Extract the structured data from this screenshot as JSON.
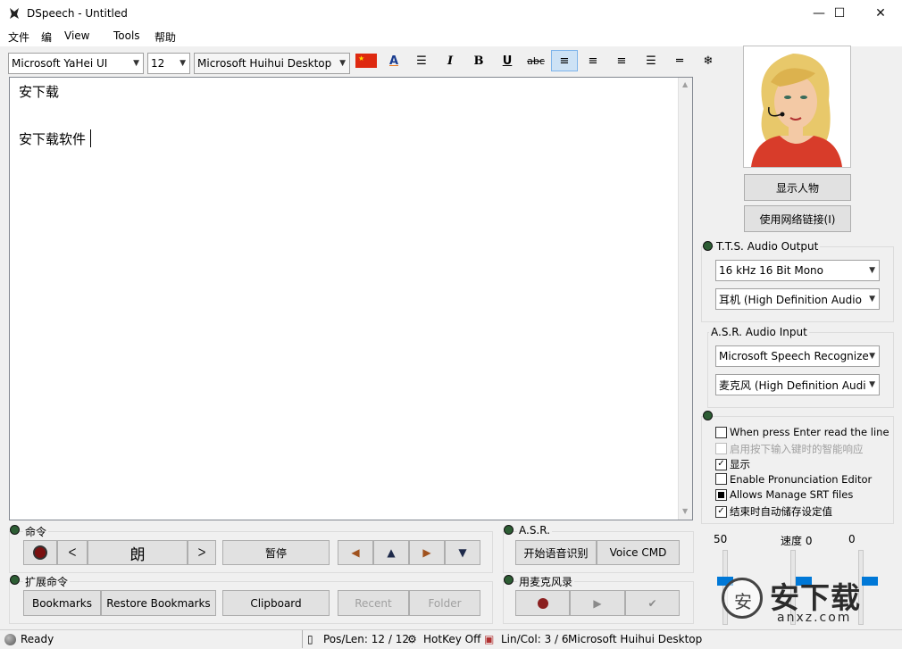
{
  "window": {
    "title": "DSpeech - Untitled",
    "minimize": "—",
    "maximize": "☐",
    "close": "✕"
  },
  "menu": [
    "文件",
    "编",
    "View",
    "Tools",
    "帮助"
  ],
  "toolbar": {
    "font_name": "Microsoft YaHei UI",
    "font_size": "12",
    "voice": "Microsoft Huihui Desktop",
    "italic": "I",
    "bold": "B",
    "underline": "U",
    "strike": "abc"
  },
  "editor": {
    "lines": [
      "安下载",
      "",
      "安下载软件"
    ]
  },
  "avatar": {
    "show_person": "显示人物",
    "use_network": "使用网络链接(I)"
  },
  "tts": {
    "label": "T.T.S. Audio Output",
    "format": "16 kHz 16 Bit Mono",
    "device": "耳机 (High Definition Audio"
  },
  "asr_input": {
    "label": "A.S.R. Audio Input",
    "engine": "Microsoft Speech Recognize",
    "device": "麦克风 (High Definition Audi"
  },
  "options": [
    {
      "label": "When press Enter read the line",
      "checked": false,
      "disabled": false,
      "style": "box"
    },
    {
      "label": "启用按下输入键时的智能响应",
      "checked": false,
      "disabled": true,
      "style": "box"
    },
    {
      "label": "显示",
      "checked": true,
      "disabled": false,
      "style": "box"
    },
    {
      "label": "Enable Pronunciation Editor",
      "checked": false,
      "disabled": false,
      "style": "box"
    },
    {
      "label": "Allows Manage SRT files",
      "checked": true,
      "disabled": false,
      "style": "square"
    },
    {
      "label": "结束时自动储存设定值",
      "checked": true,
      "disabled": false,
      "style": "box"
    }
  ],
  "commands": {
    "label": "命令",
    "read": "朗",
    "pause": "暂停"
  },
  "extended": {
    "label": "扩展命令",
    "bookmarks": "Bookmarks",
    "restore_bookmarks": "Restore Bookmarks",
    "clipboard": "Clipboard",
    "recent": "Recent",
    "folder": "Folder"
  },
  "asr": {
    "label": "A.S.R.",
    "start": "开始语音识别",
    "voice_cmd": "Voice CMD"
  },
  "mic": {
    "label": "用麦克风录"
  },
  "sliders": {
    "volume": "50",
    "speed": "速度 0",
    "pitch": "0"
  },
  "status": {
    "ready": "Ready",
    "pos_len": "Pos/Len: 12 / 12",
    "hotkey": "HotKey Off",
    "lin_col": "Lin/Col: 3 / 6",
    "voice": "Microsoft Huihui Desktop"
  },
  "watermark": {
    "brand": "安下载",
    "domain": "anxz.com"
  },
  "colors": {
    "accent": "#0078d7",
    "active_align_bg": "#cde2f5",
    "record_dot": "#8b2020"
  }
}
